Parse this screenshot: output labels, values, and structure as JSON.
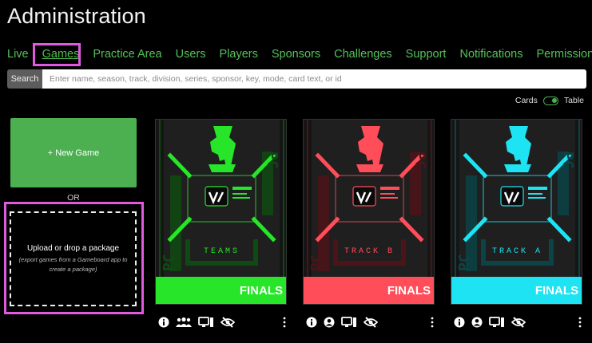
{
  "page": {
    "title": "Administration"
  },
  "nav": {
    "items": [
      {
        "label": "Live"
      },
      {
        "label": "Games"
      },
      {
        "label": "Practice Area"
      },
      {
        "label": "Users"
      },
      {
        "label": "Players"
      },
      {
        "label": "Sponsors"
      },
      {
        "label": "Challenges"
      },
      {
        "label": "Support"
      },
      {
        "label": "Notifications"
      },
      {
        "label": "Permissions"
      }
    ],
    "active": "Games"
  },
  "search": {
    "button_label": "Search",
    "placeholder": "Enter name, season, track, division, series, sponsor, key, mode, card text, or id",
    "value": ""
  },
  "view_toggle": {
    "left_label": "Cards",
    "right_label": "Table",
    "selected": "Table"
  },
  "new_game": {
    "label": "+ New Game"
  },
  "or_label": "OR",
  "upload": {
    "title": "Upload or drop a package",
    "hint": "(export games from a Gameboard app to create a package)"
  },
  "colors": {
    "accent": "#4caf50",
    "highlight": "#e05ae0"
  },
  "cards": [
    {
      "banner": "FINALS",
      "track": "TEAMS",
      "color": "#27e62a",
      "dim": "#0f4a12",
      "icons": [
        "info-icon",
        "team-icon",
        "monitor-icon",
        "hidden-icon"
      ]
    },
    {
      "banner": "FINALS",
      "track": "TRACK B",
      "color": "#ff4d5a",
      "dim": "#4c1419",
      "icons": [
        "info-icon",
        "player-icon",
        "monitor-icon",
        "hidden-icon"
      ]
    },
    {
      "banner": "FINALS",
      "track": "TRACK A",
      "color": "#1ee3f2",
      "dim": "#0c4347",
      "icons": [
        "info-icon",
        "player-icon",
        "monitor-icon",
        "hidden-icon"
      ]
    }
  ]
}
